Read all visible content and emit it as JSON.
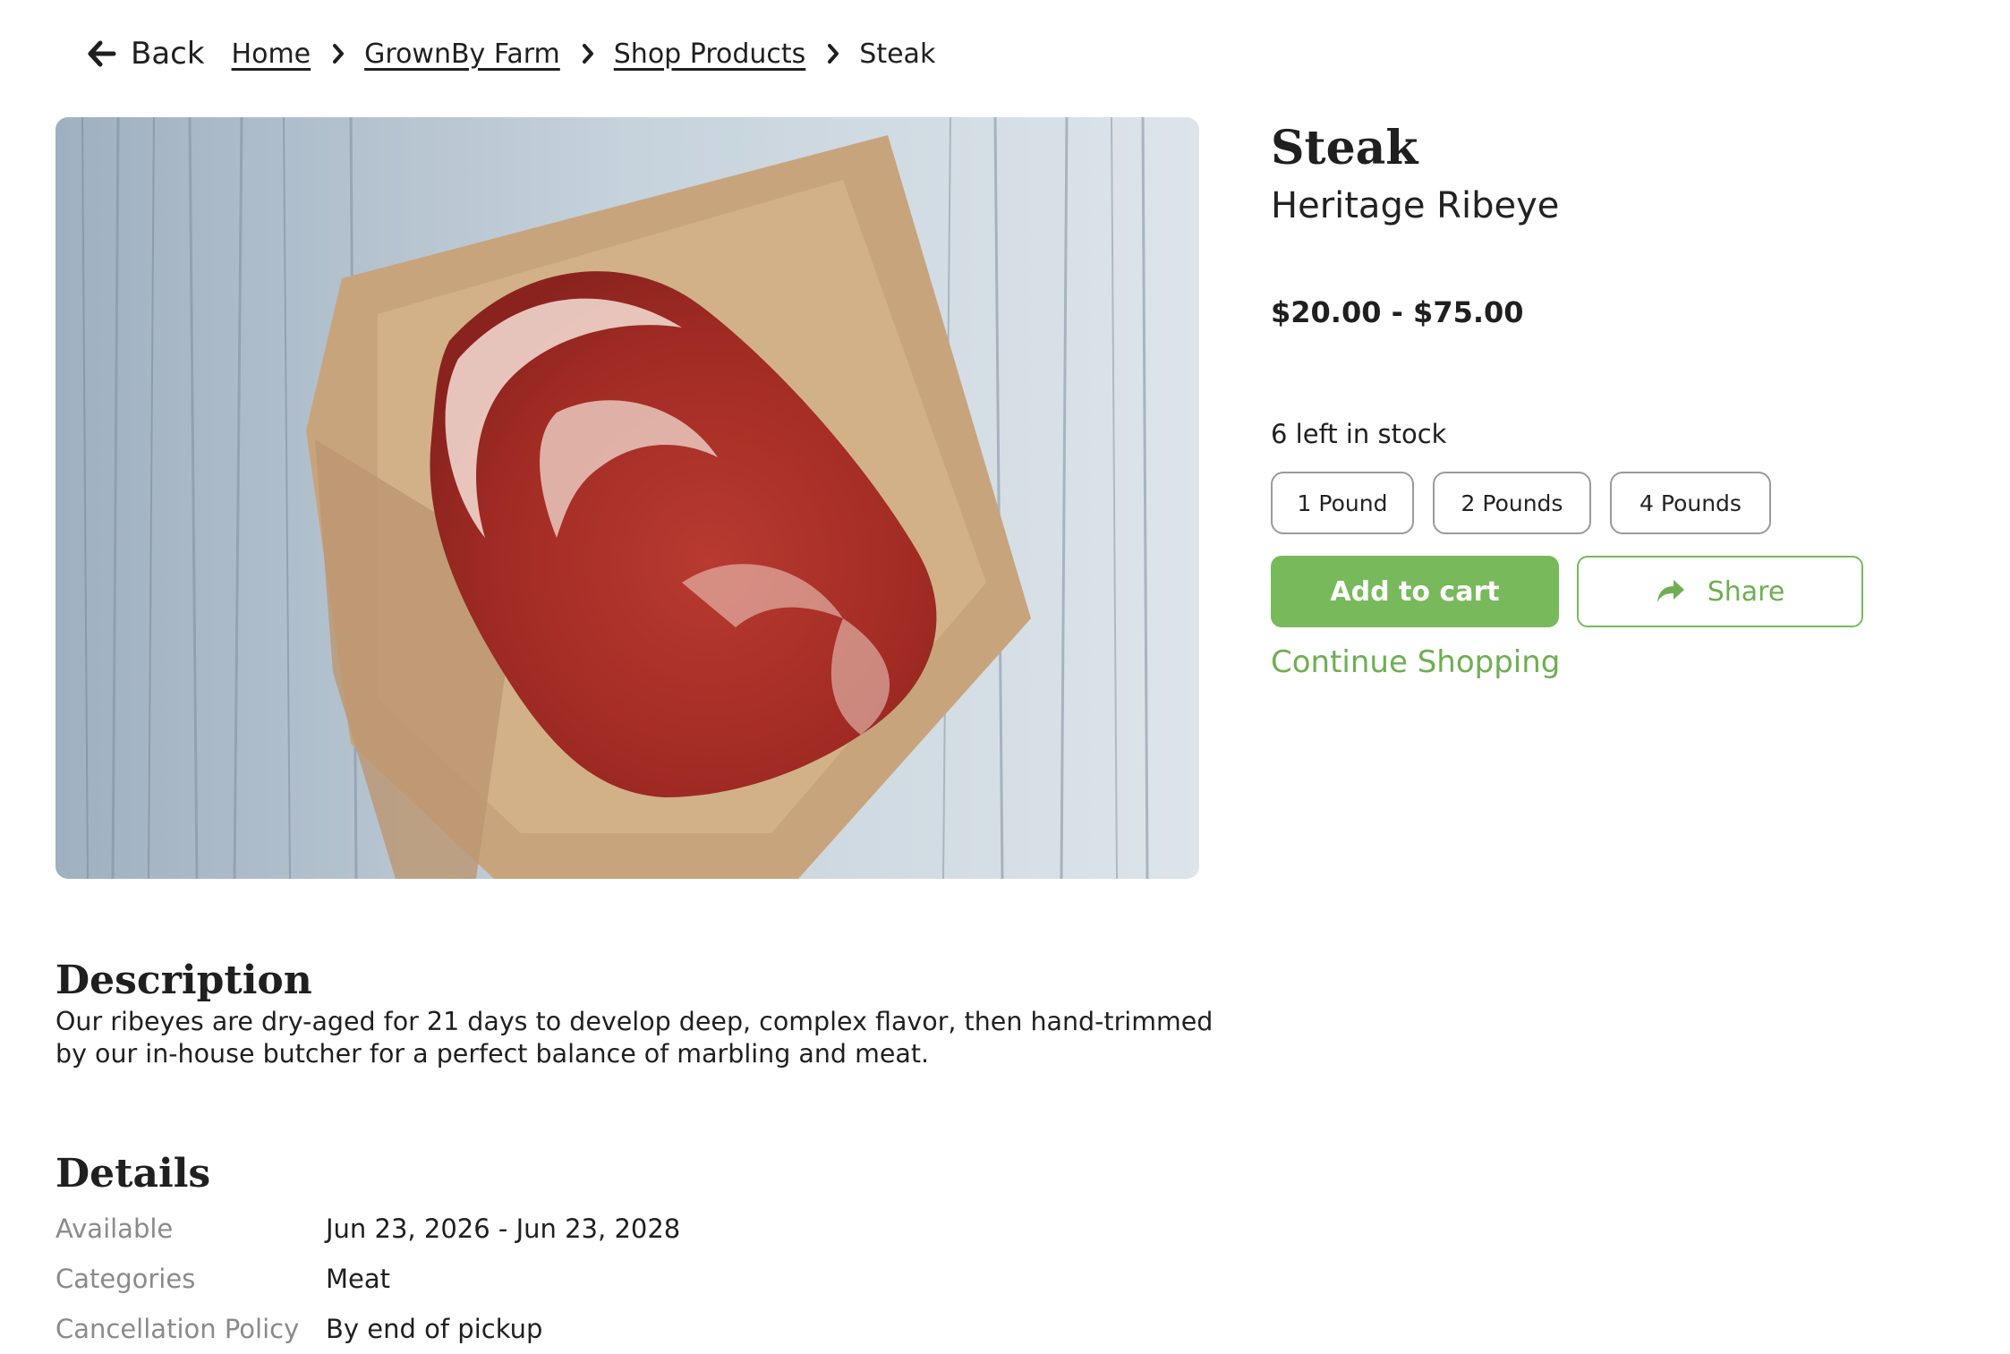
{
  "nav": {
    "back_label": "Back",
    "breadcrumbs": [
      "Home",
      "GrownBy Farm",
      "Shop Products"
    ],
    "current": "Steak"
  },
  "product": {
    "name": "Steak",
    "variety": "Heritage Ribeye",
    "price_range": "$20.00 - $75.00",
    "stock_text": "6 left in stock",
    "options": [
      "1 Pound",
      "2 Pounds",
      "4 Pounds"
    ],
    "add_to_cart_label": "Add to cart",
    "share_label": "Share",
    "continue_label": "Continue Shopping"
  },
  "description": {
    "heading": "Description",
    "text": "Our ribeyes are dry-aged for 21 days to develop deep, complex flavor, then hand-trimmed by our in-house butcher for a perfect balance of marbling and meat."
  },
  "details": {
    "heading": "Details",
    "rows": [
      {
        "label": "Available",
        "value": "Jun 23, 2026 - Jun 23, 2028"
      },
      {
        "label": "Categories",
        "value": "Meat"
      },
      {
        "label": "Cancellation Policy",
        "value": "By end of pickup"
      }
    ]
  },
  "colors": {
    "accent": "#78b95b",
    "accent_text": "#6fae52",
    "muted_label": "#8a8a8a"
  },
  "icons": [
    "arrow-left-icon",
    "chevron-right-icon",
    "share-arrow-icon"
  ]
}
